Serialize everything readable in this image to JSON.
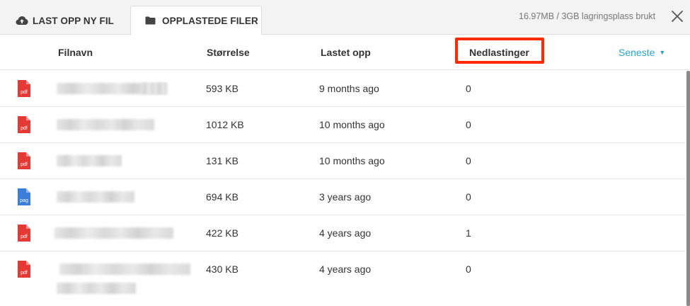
{
  "tabs": {
    "upload_label": "LAST OPP NY FIL",
    "uploaded_label": "OPPLASTEDE FILER"
  },
  "storage_text": "16.97MB / 3GB lagringsplass brukt",
  "columns": {
    "name": "Filnavn",
    "size": "Størrelse",
    "uploaded": "Lastet opp",
    "downloads": "Nedlastinger"
  },
  "sort": {
    "label": "Seneste",
    "caret": "▼"
  },
  "files": [
    {
      "type": "pdf",
      "size": "593 KB",
      "uploaded": "9 months ago",
      "downloads": "0",
      "icon_color": "#e53935"
    },
    {
      "type": "pdf",
      "size": "1012 KB",
      "uploaded": "10 months ago",
      "downloads": "0",
      "icon_color": "#e53935"
    },
    {
      "type": "pdf",
      "size": "131 KB",
      "uploaded": "10 months ago",
      "downloads": "0",
      "icon_color": "#e53935"
    },
    {
      "type": "pag",
      "size": "694 KB",
      "uploaded": "3 years ago",
      "downloads": "0",
      "icon_color": "#3b7dd8"
    },
    {
      "type": "pdf",
      "size": "422 KB",
      "uploaded": "4 years ago",
      "downloads": "1",
      "icon_color": "#e53935"
    },
    {
      "type": "pdf",
      "size": "430 KB",
      "uploaded": "4 years ago",
      "downloads": "0",
      "icon_color": "#e53935"
    }
  ],
  "icons": {
    "upload": "cloud-upload-icon",
    "folder": "folder-icon",
    "close": "close-icon",
    "file": "file-icon"
  },
  "colors": {
    "accent": "#2aa3c9",
    "highlight_box": "#ff2a00"
  }
}
